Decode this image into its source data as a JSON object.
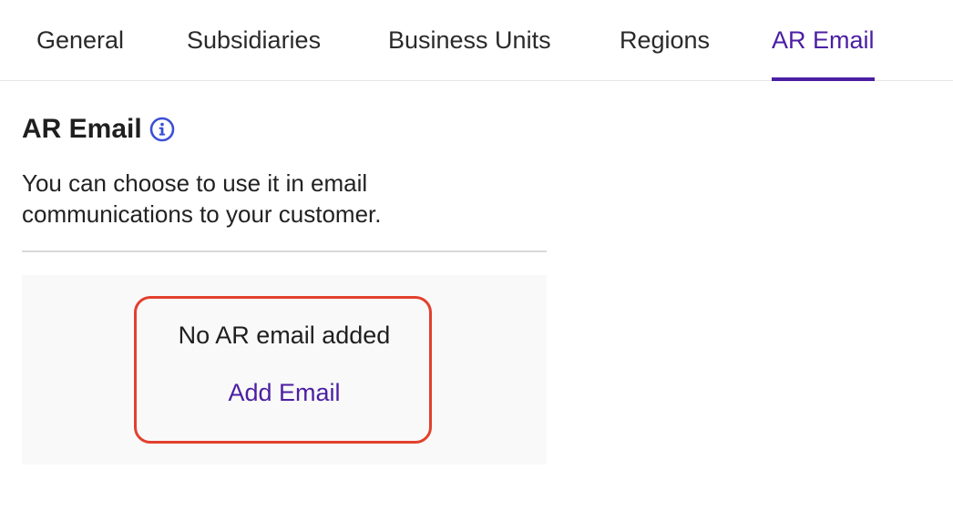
{
  "tabs": [
    {
      "label": "General",
      "active": false
    },
    {
      "label": "Subsidiaries",
      "active": false
    },
    {
      "label": "Business Units",
      "active": false
    },
    {
      "label": "Regions",
      "active": false
    },
    {
      "label": "AR Email",
      "active": true
    }
  ],
  "section": {
    "title": "AR Email",
    "info_icon": "info-circle-icon",
    "description": "You can choose to use it in email communications to your customer."
  },
  "empty_state": {
    "message": "No AR email added",
    "action_label": "Add Email"
  },
  "colors": {
    "accent": "#4b1fa3",
    "highlight_border": "#e2402d",
    "info_icon": "#3b4fd6",
    "panel_bg": "#f9f9f9"
  }
}
